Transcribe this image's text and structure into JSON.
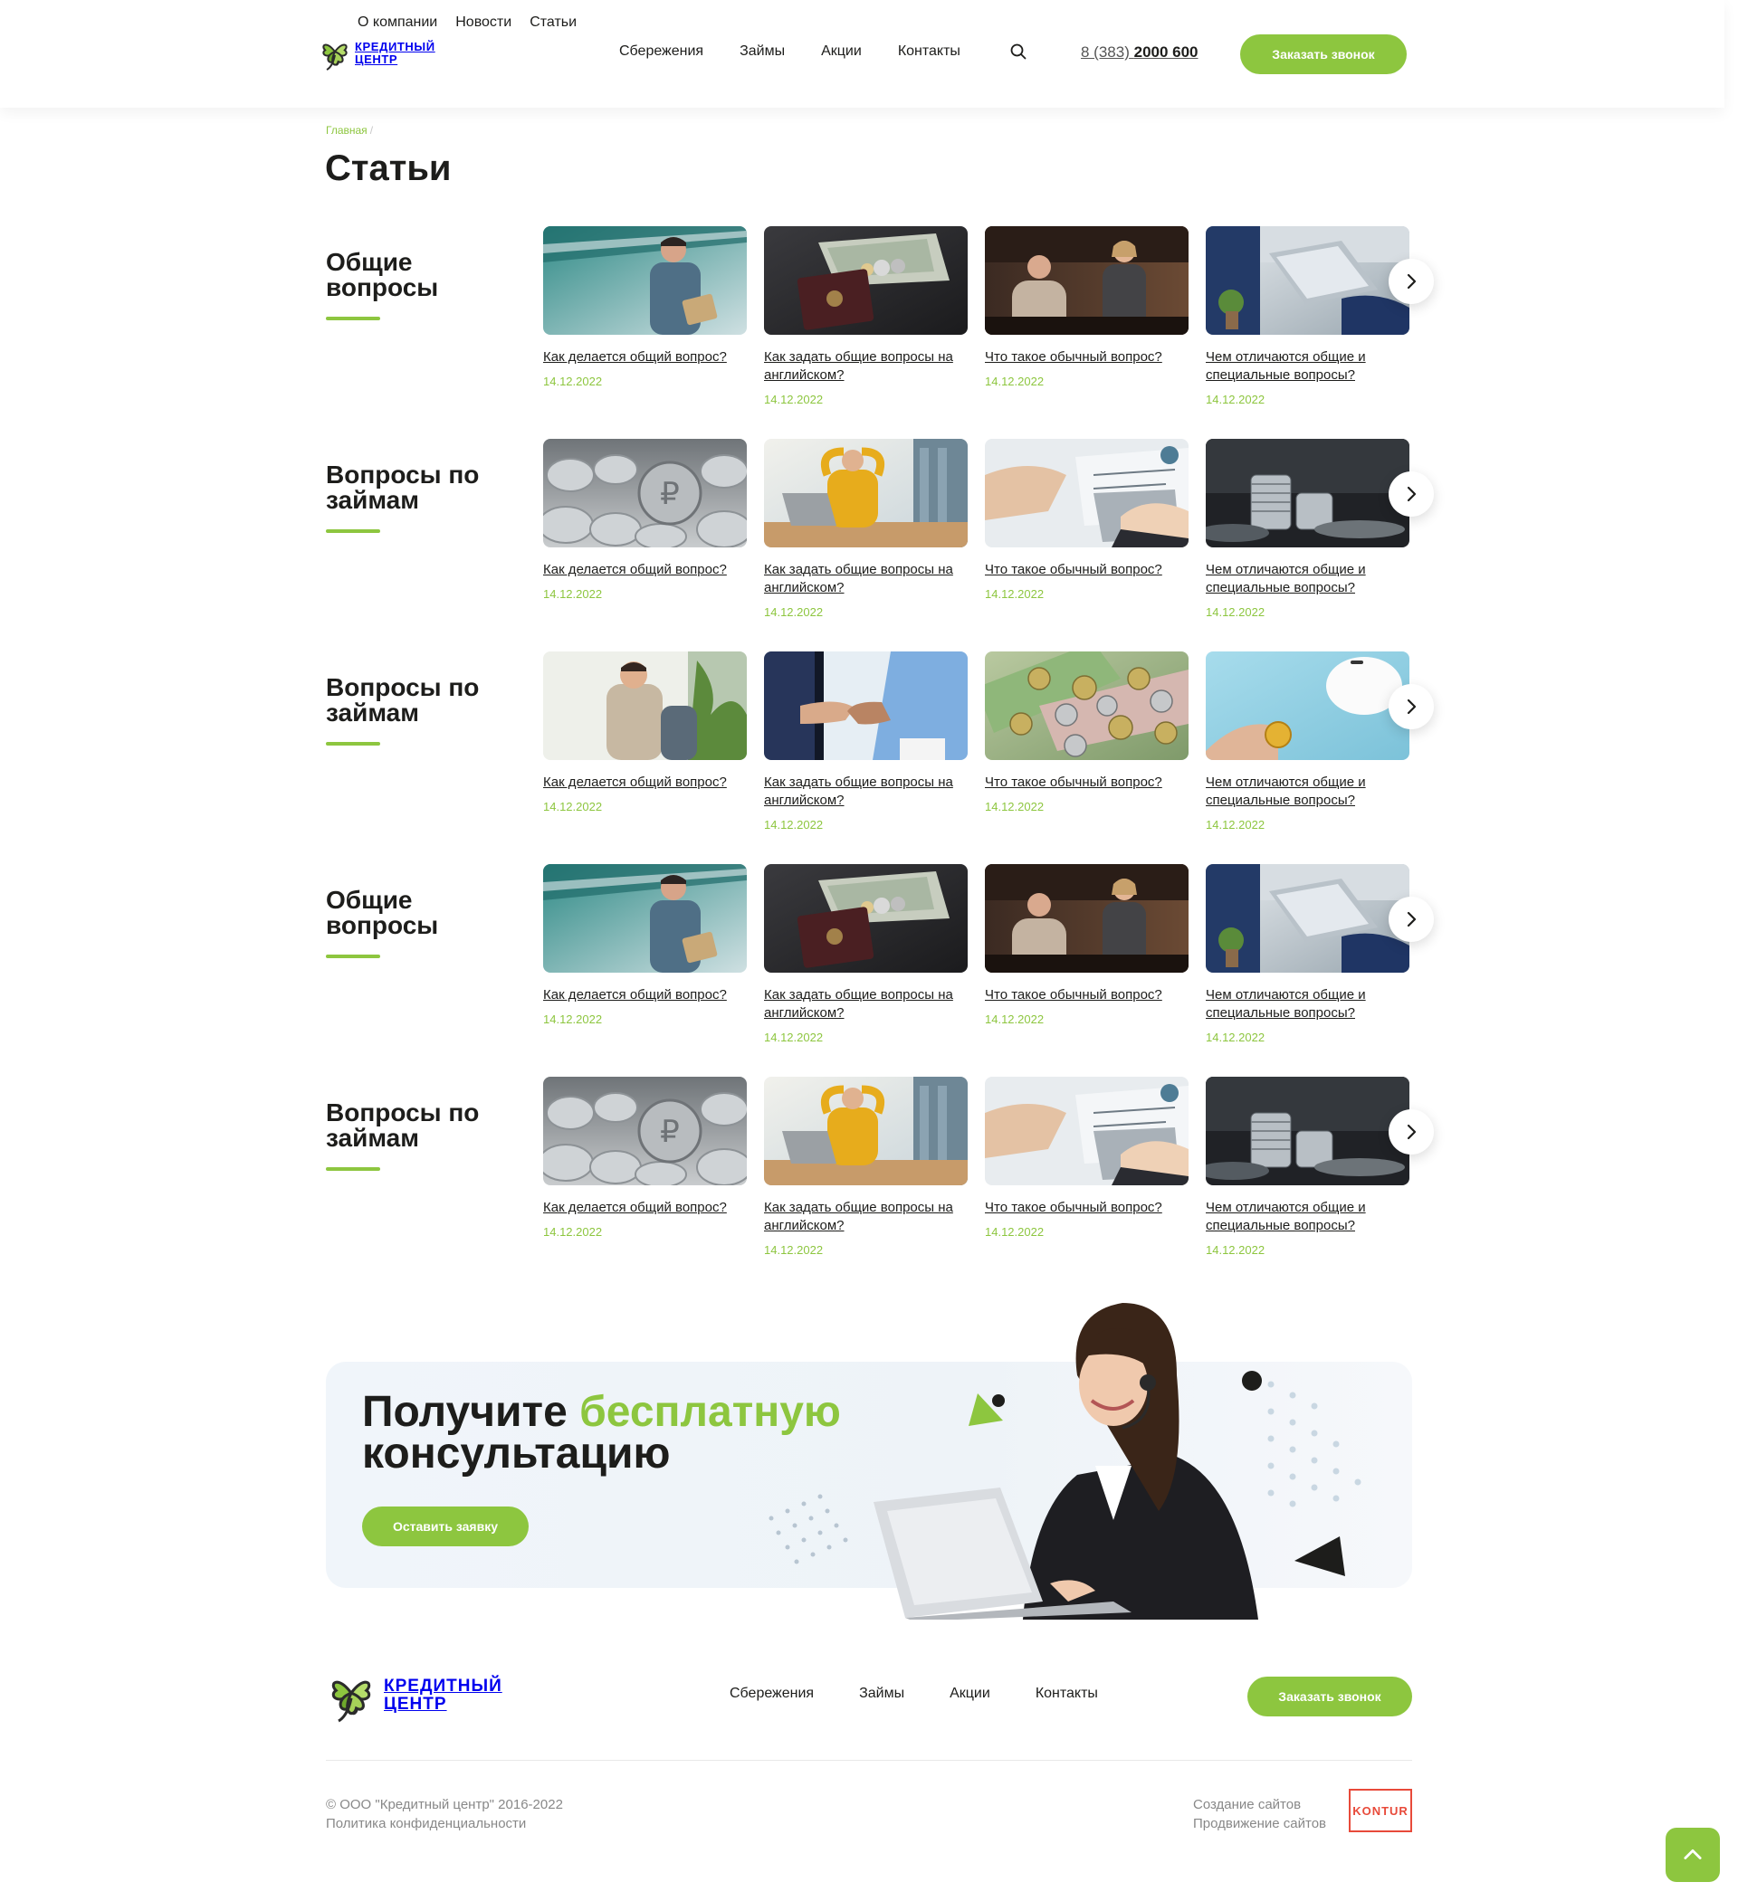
{
  "brand": {
    "name_line1": "Кредитный",
    "name_line2": "центр",
    "green": "#8dc63f",
    "dark": "#1d1d1b"
  },
  "header": {
    "top_links": [
      "О компании",
      "Новости",
      "Статьи"
    ],
    "main_links": [
      "Сбережения",
      "Займы",
      "Акции",
      "Контакты"
    ],
    "search_icon": "search-icon",
    "phone_prefix": "8 (383)",
    "phone_number": "2000 600",
    "callback_label": "Заказать звонок"
  },
  "breadcrumb": {
    "home": "Главная",
    "separator": "/"
  },
  "page_title": "Статьи",
  "sections": [
    {
      "title": "Общие вопросы",
      "cards": [
        {
          "title": "Как делается общий вопрос?",
          "date": "14.12.2022",
          "image": "man-with-folder-office"
        },
        {
          "title": "Как задать общие вопросы на английском?",
          "date": "14.12.2022",
          "image": "passport-with-banknotes"
        },
        {
          "title": "Что такое обычный вопрос?",
          "date": "14.12.2022",
          "image": "two-women-talking"
        },
        {
          "title": "Чем отличаются общие и специальные вопросы?",
          "date": "14.12.2022",
          "image": "laptop-at-desk"
        }
      ]
    },
    {
      "title": "Вопросы по займам",
      "cards": [
        {
          "title": "Как делается общий вопрос?",
          "date": "14.12.2022",
          "image": "ruble-coins"
        },
        {
          "title": "Как задать общие вопросы на английском?",
          "date": "14.12.2022",
          "image": "woman-relaxing-at-laptop"
        },
        {
          "title": "Что такое обычный вопрос?",
          "date": "14.12.2022",
          "image": "charts-and-laptop"
        },
        {
          "title": "Чем отличаются общие и специальные вопросы?",
          "date": "14.12.2022",
          "image": "coin-stacks"
        }
      ]
    },
    {
      "title": "Вопросы по займам",
      "cards": [
        {
          "title": "Как делается общий вопрос?",
          "date": "14.12.2022",
          "image": "smiling-businessman"
        },
        {
          "title": "Как задать общие вопросы на английском?",
          "date": "14.12.2022",
          "image": "handshake"
        },
        {
          "title": "Что такое обычный вопрос?",
          "date": "14.12.2022",
          "image": "banknotes-and-coins"
        },
        {
          "title": "Чем отличаются общие и специальные вопросы?",
          "date": "14.12.2022",
          "image": "piggy-bank-coin"
        }
      ]
    },
    {
      "title": "Общие вопросы",
      "cards": [
        {
          "title": "Как делается общий вопрос?",
          "date": "14.12.2022",
          "image": "man-with-folder-office"
        },
        {
          "title": "Как задать общие вопросы на английском?",
          "date": "14.12.2022",
          "image": "passport-with-banknotes"
        },
        {
          "title": "Что такое обычный вопрос?",
          "date": "14.12.2022",
          "image": "two-women-talking"
        },
        {
          "title": "Чем отличаются общие и специальные вопросы?",
          "date": "14.12.2022",
          "image": "laptop-at-desk"
        }
      ]
    },
    {
      "title": "Вопросы по займам",
      "cards": [
        {
          "title": "Как делается общий вопрос?",
          "date": "14.12.2022",
          "image": "ruble-coins"
        },
        {
          "title": "Как задать общие вопросы на английском?",
          "date": "14.12.2022",
          "image": "woman-relaxing-at-laptop"
        },
        {
          "title": "Что такое обычный вопрос?",
          "date": "14.12.2022",
          "image": "charts-and-laptop"
        },
        {
          "title": "Чем отличаются общие и специальные вопросы?",
          "date": "14.12.2022",
          "image": "coin-stacks"
        }
      ]
    }
  ],
  "promo": {
    "title_line1_start": "Получите",
    "title_line1_accent": "бесплатную",
    "title_line2": "консультацию",
    "button_label": "Оставить заявку",
    "image": "consultant-with-headset"
  },
  "footer": {
    "links": [
      "Сбережения",
      "Займы",
      "Акции",
      "Контакты"
    ],
    "callback_label": "Заказать звонок",
    "copyright": "© ООО \"Кредитный центр\" 2016-2022",
    "privacy": "Политика конфиденциальности",
    "dev_line1": "Создание сайтов",
    "dev_line2": "Продвижение сайтов",
    "dev_logo": "KONTUR",
    "scroll_top_icon": "chevron-up-icon"
  }
}
